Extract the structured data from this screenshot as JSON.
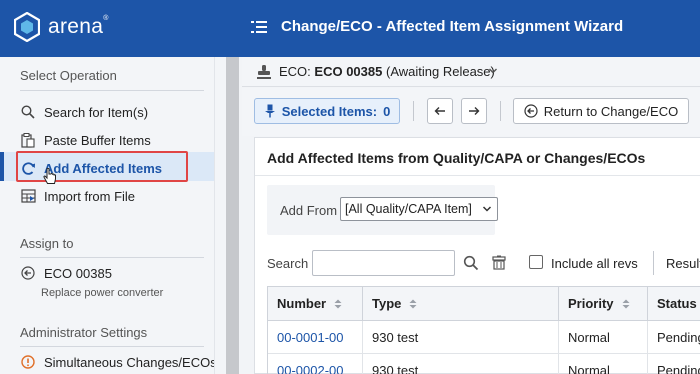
{
  "header": {
    "logo_text": "arena",
    "logo_tm": "®",
    "title": "Change/ECO - Affected Item Assignment Wizard",
    "brand_color": "#1d55a8"
  },
  "sidebar": {
    "select_operation": {
      "heading": "Select Operation",
      "items": [
        {
          "label": "Search for Item(s)",
          "icon": "search-icon"
        },
        {
          "label": "Paste Buffer Items",
          "icon": "clipboard-icon"
        },
        {
          "label": "Add Affected Items",
          "icon": "refresh-icon",
          "active": true
        },
        {
          "label": "Import from File",
          "icon": "import-file-icon"
        }
      ]
    },
    "assign_to": {
      "heading": "Assign to",
      "eco_label": "ECO 00385",
      "eco_description": "Replace power converter"
    },
    "admin": {
      "heading": "Administrator Settings",
      "items": [
        {
          "label": "Simultaneous Changes/ECOs",
          "icon": "warning-circle-icon"
        }
      ]
    }
  },
  "eco_bar": {
    "prefix": "ECO:",
    "number": "ECO 00385",
    "status": "(Awaiting Release)"
  },
  "toolbar": {
    "selected_label": "Selected Items:",
    "selected_count": "0",
    "return_label": "Return to Change/ECO"
  },
  "panel": {
    "title": "Add Affected Items from Quality/CAPA or Changes/ECOs",
    "add_from_label": "Add From",
    "add_from_value": "[All Quality/CAPA Item]",
    "search_label": "Search",
    "search_value": "",
    "include_all_revs_label": "Include all revs",
    "include_all_revs_checked": false,
    "results_label": "Result"
  },
  "table": {
    "columns": [
      "Number",
      "Type",
      "Priority",
      "Status"
    ],
    "rows": [
      {
        "number": "00-0001-00",
        "type": "930 test",
        "priority": "Normal",
        "status": "Pending"
      },
      {
        "number": "00-0002-00",
        "type": "930 test",
        "priority": "Normal",
        "status": "Pending"
      }
    ]
  }
}
